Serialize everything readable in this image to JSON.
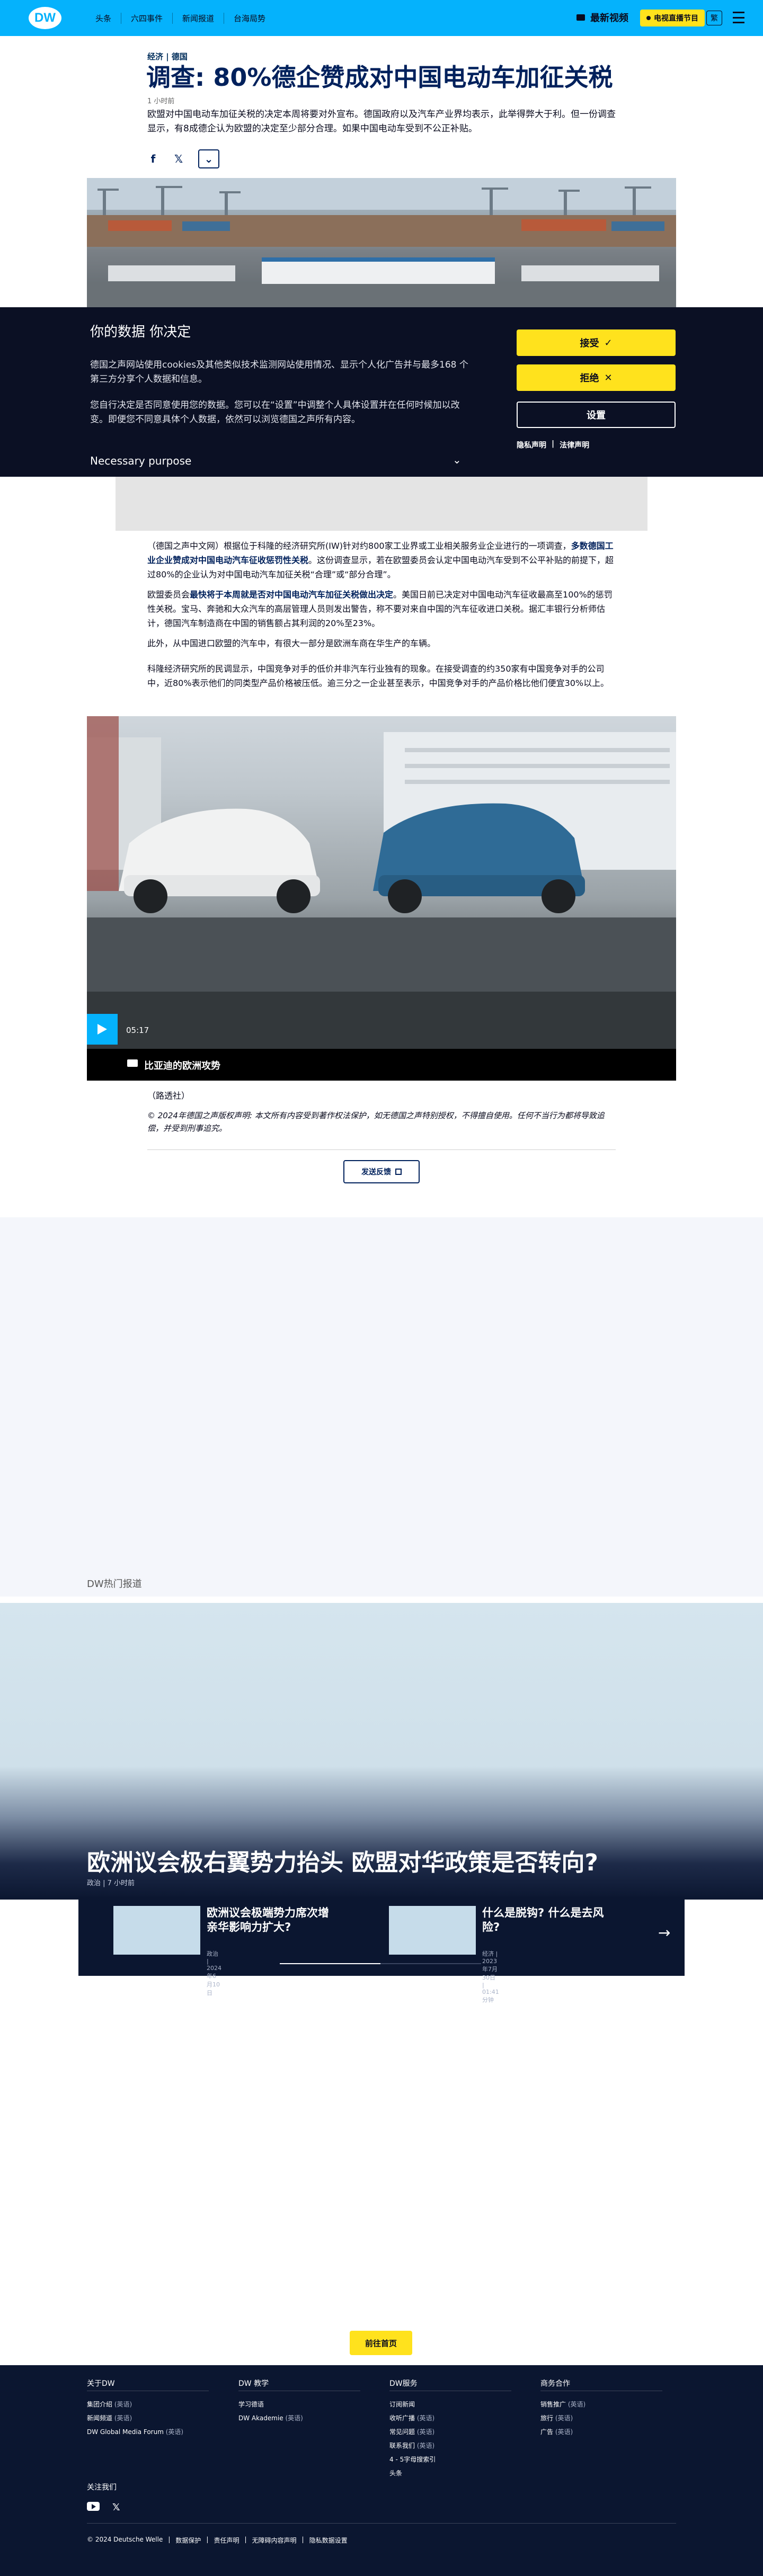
{
  "header": {
    "logo": "DW",
    "nav": [
      "头条",
      "六四事件",
      "新闻报道",
      "台海局势"
    ],
    "latest_video": "最新视频",
    "live_tv": "电视直播节目",
    "language": "繁"
  },
  "article": {
    "kicker": "经济 | 德国",
    "title": "调查: 80%德企赞成对中国电动车加征关税",
    "time_ago": "1 小时前",
    "teaser": "欧盟对中国电动车加征关税的决定本周将要对外宣布。德国政府以及汽车产业界均表示，此举得弊大于利。但一份调查显示，有8成德企认为欧盟的决定至少部分合理。如果中国电动车受到不公正补贴。",
    "share_icons": [
      "facebook-icon",
      "x-icon",
      "chevron-down-icon"
    ]
  },
  "consent": {
    "title": "你的数据 你决定",
    "p1": "德国之声网站使用cookies及其他类似技术监测网站使用情况、显示个人化广告并与最多168 个第三方分享个人数据和信息。",
    "p2": "您自行决定是否同意使用您的数据。您可以在“设置”中调整个人具体设置并在任何时候加以改变。即便您不同意具体个人数据，依然可以浏览德国之声所有内容。",
    "purpose": "Necessary purpose",
    "accept": "接受",
    "reject": "拒绝",
    "settings": "设置",
    "privacy": "隐私声明",
    "legal": "法律声明"
  },
  "body": {
    "p1_before": "（德国之声中文网）根据位于科隆的经济研究所(IW)针对约800家工业界或工业相关服务业企业进行的一项调查，",
    "p1_bold": "多数德国工业企业赞成对中国电动汽车征收惩罚性关税",
    "p1_after": "。这份调查显示，若在欧盟委员会认定中国电动汽车受到不公平补贴的前提下，超过80%的企业认为对中国电动汽车加征关税“合理”或“部分合理”。",
    "p2_before": "欧盟委员会",
    "p2_bold": "最快将于本周就是否对中国电动汽车加征关税做出决定",
    "p2_after": "。美国日前已决定对中国电动汽车征收最高至100%的惩罚性关税。宝马、奔驰和大众汽车的高层管理人员则发出警告，称不要对来自中国的汽车征收进口关税。据汇丰银行分析师估计，德国汽车制造商在中国的销售额占其利润的20%至23%。",
    "p3": "此外，从中国进口欧盟的汽车中，有很大一部分是欧洲车商在华生产的车辆。",
    "p4": "科隆经济研究所的民调显示，中国竞争对手的低价并非汽车行业独有的现象。在接受调查的约350家有中国竞争对手的公司中，近80%表示他们的同类型产品价格被压低。逾三分之一企业甚至表示，中国竞争对手的产品价格比他们便宜30%以上。",
    "video_duration": "05:17",
    "video_caption": "比亚迪的欧洲攻势",
    "byline": "（路透社）",
    "copyright": "© 2024年德国之声版权声明: 本文所有内容受到著作权法保护，如无德国之声特别授权，不得擅自使用。任何不当行为都将导致追偿，并受到刑事追究。",
    "feedback": "发送反馈"
  },
  "trending": {
    "label": "DW热门报道",
    "feature_title": "欧洲议会极右翼势力抬头 欧盟对华政策是否转向?",
    "feature_meta": "政治 | 7 小时前",
    "items": [
      {
        "title": "欧洲议会极端势力席次增 亲华影响力扩大?",
        "meta": "政治 | 2024年6月10日"
      },
      {
        "title": "什么是脱钩? 什么是去风险?",
        "meta": "经济 | 2023年7月30日 | 01:41 分钟"
      }
    ]
  },
  "home_button": "前往首页",
  "footer": {
    "columns": [
      {
        "heading": "关于DW",
        "items": [
          {
            "label": "集团介绍",
            "lang": "(英语)"
          },
          {
            "label": "新闻频道",
            "lang": "(英语)"
          },
          {
            "label": "DW Global Media Forum",
            "lang": "(英语)"
          }
        ]
      },
      {
        "heading": "DW 教学",
        "items": [
          {
            "label": "学习德语",
            "lang": ""
          },
          {
            "label": "DW Akademie",
            "lang": "(英语)"
          }
        ]
      },
      {
        "heading": "DW服务",
        "items": [
          {
            "label": "订阅新闻",
            "lang": ""
          },
          {
            "label": "收听广播",
            "lang": "(英语)"
          },
          {
            "label": "常见问题",
            "lang": "(英语)"
          },
          {
            "label": "联系我们",
            "lang": "(英语)"
          },
          {
            "label": "4 - 5字母搜索引",
            "lang": ""
          },
          {
            "label": "头条",
            "lang": ""
          }
        ]
      },
      {
        "heading": "商务合作",
        "items": [
          {
            "label": "销售推广",
            "lang": "(英语)"
          },
          {
            "label": "旅行",
            "lang": "(英语)"
          },
          {
            "label": "广告",
            "lang": "(英语)"
          }
        ]
      }
    ],
    "follow": "关注我们",
    "social": [
      "youtube-icon",
      "x-icon"
    ],
    "legal": [
      "© 2024 Deutsche Welle",
      "数据保护",
      "责任声明",
      "无障碍内容声明",
      "隐私数据设置"
    ]
  }
}
